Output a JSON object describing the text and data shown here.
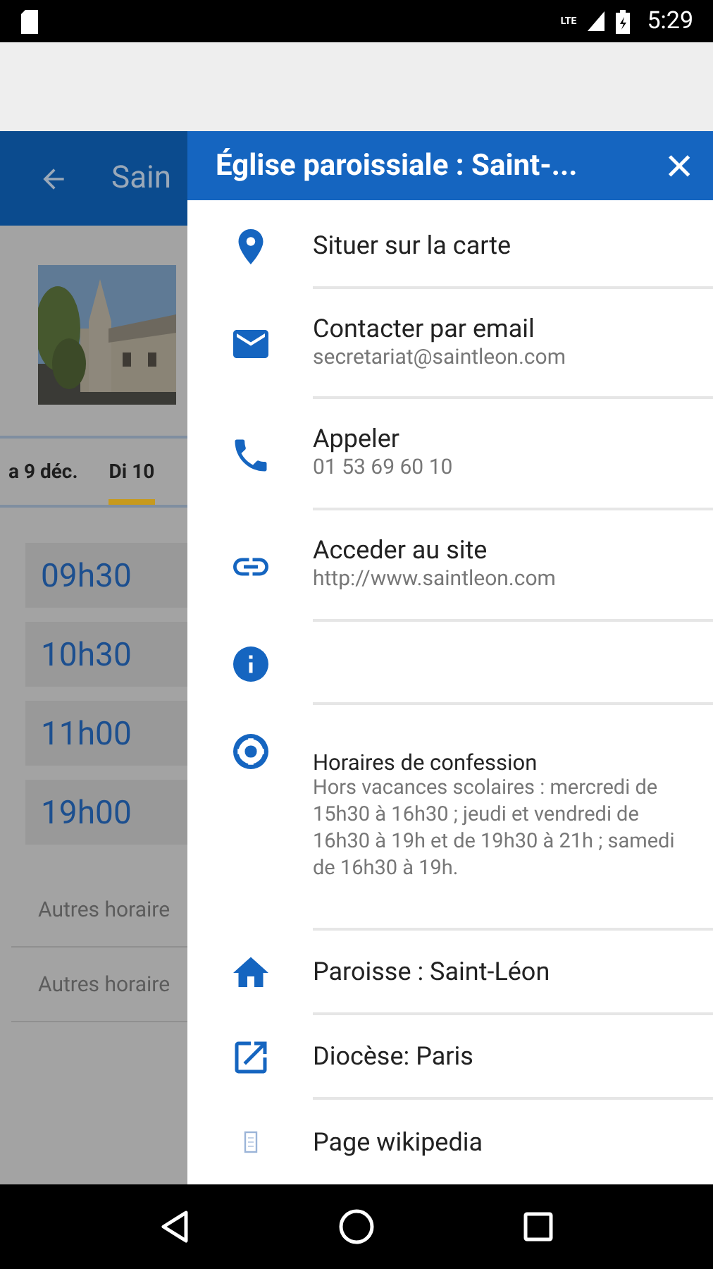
{
  "status_bar": {
    "time": "5:29",
    "network": "LTE"
  },
  "page": {
    "title": "Sain",
    "tabs": [
      {
        "label": "a 9 déc.",
        "selected": false
      },
      {
        "label": "Di 10",
        "selected": true
      }
    ],
    "times": [
      "09h30",
      "10h30",
      "11h00",
      "19h00"
    ],
    "links": [
      "Autres horaire",
      "Autres horaire"
    ]
  },
  "drawer": {
    "title": "Église paroissiale : Saint-...",
    "close": "×",
    "items": [
      {
        "kind": "action",
        "title": "Situer sur la carte"
      },
      {
        "kind": "detail",
        "title": "Contacter par email",
        "subtitle": "secretariat@saintleon.com"
      },
      {
        "kind": "detail",
        "title": "Appeler",
        "subtitle": "01 53 69 60 10"
      },
      {
        "kind": "detail",
        "title": "Acceder au site",
        "subtitle": "http://www.saintleon.com"
      },
      {
        "kind": "icon"
      },
      {
        "kind": "note",
        "title": "Horaires de confession",
        "subtitle": "Hors vacances scolaires : mercredi de 15h30 à 16h30 ; jeudi et vendredi de 16h30 à 19h et de 19h30 à 21h ; samedi de 16h30 à 19h."
      },
      {
        "kind": "action",
        "title": "Paroisse : Saint-Léon"
      },
      {
        "kind": "action",
        "title": "Diocèse: Paris"
      },
      {
        "kind": "action",
        "title": "Page wikipedia"
      }
    ]
  }
}
